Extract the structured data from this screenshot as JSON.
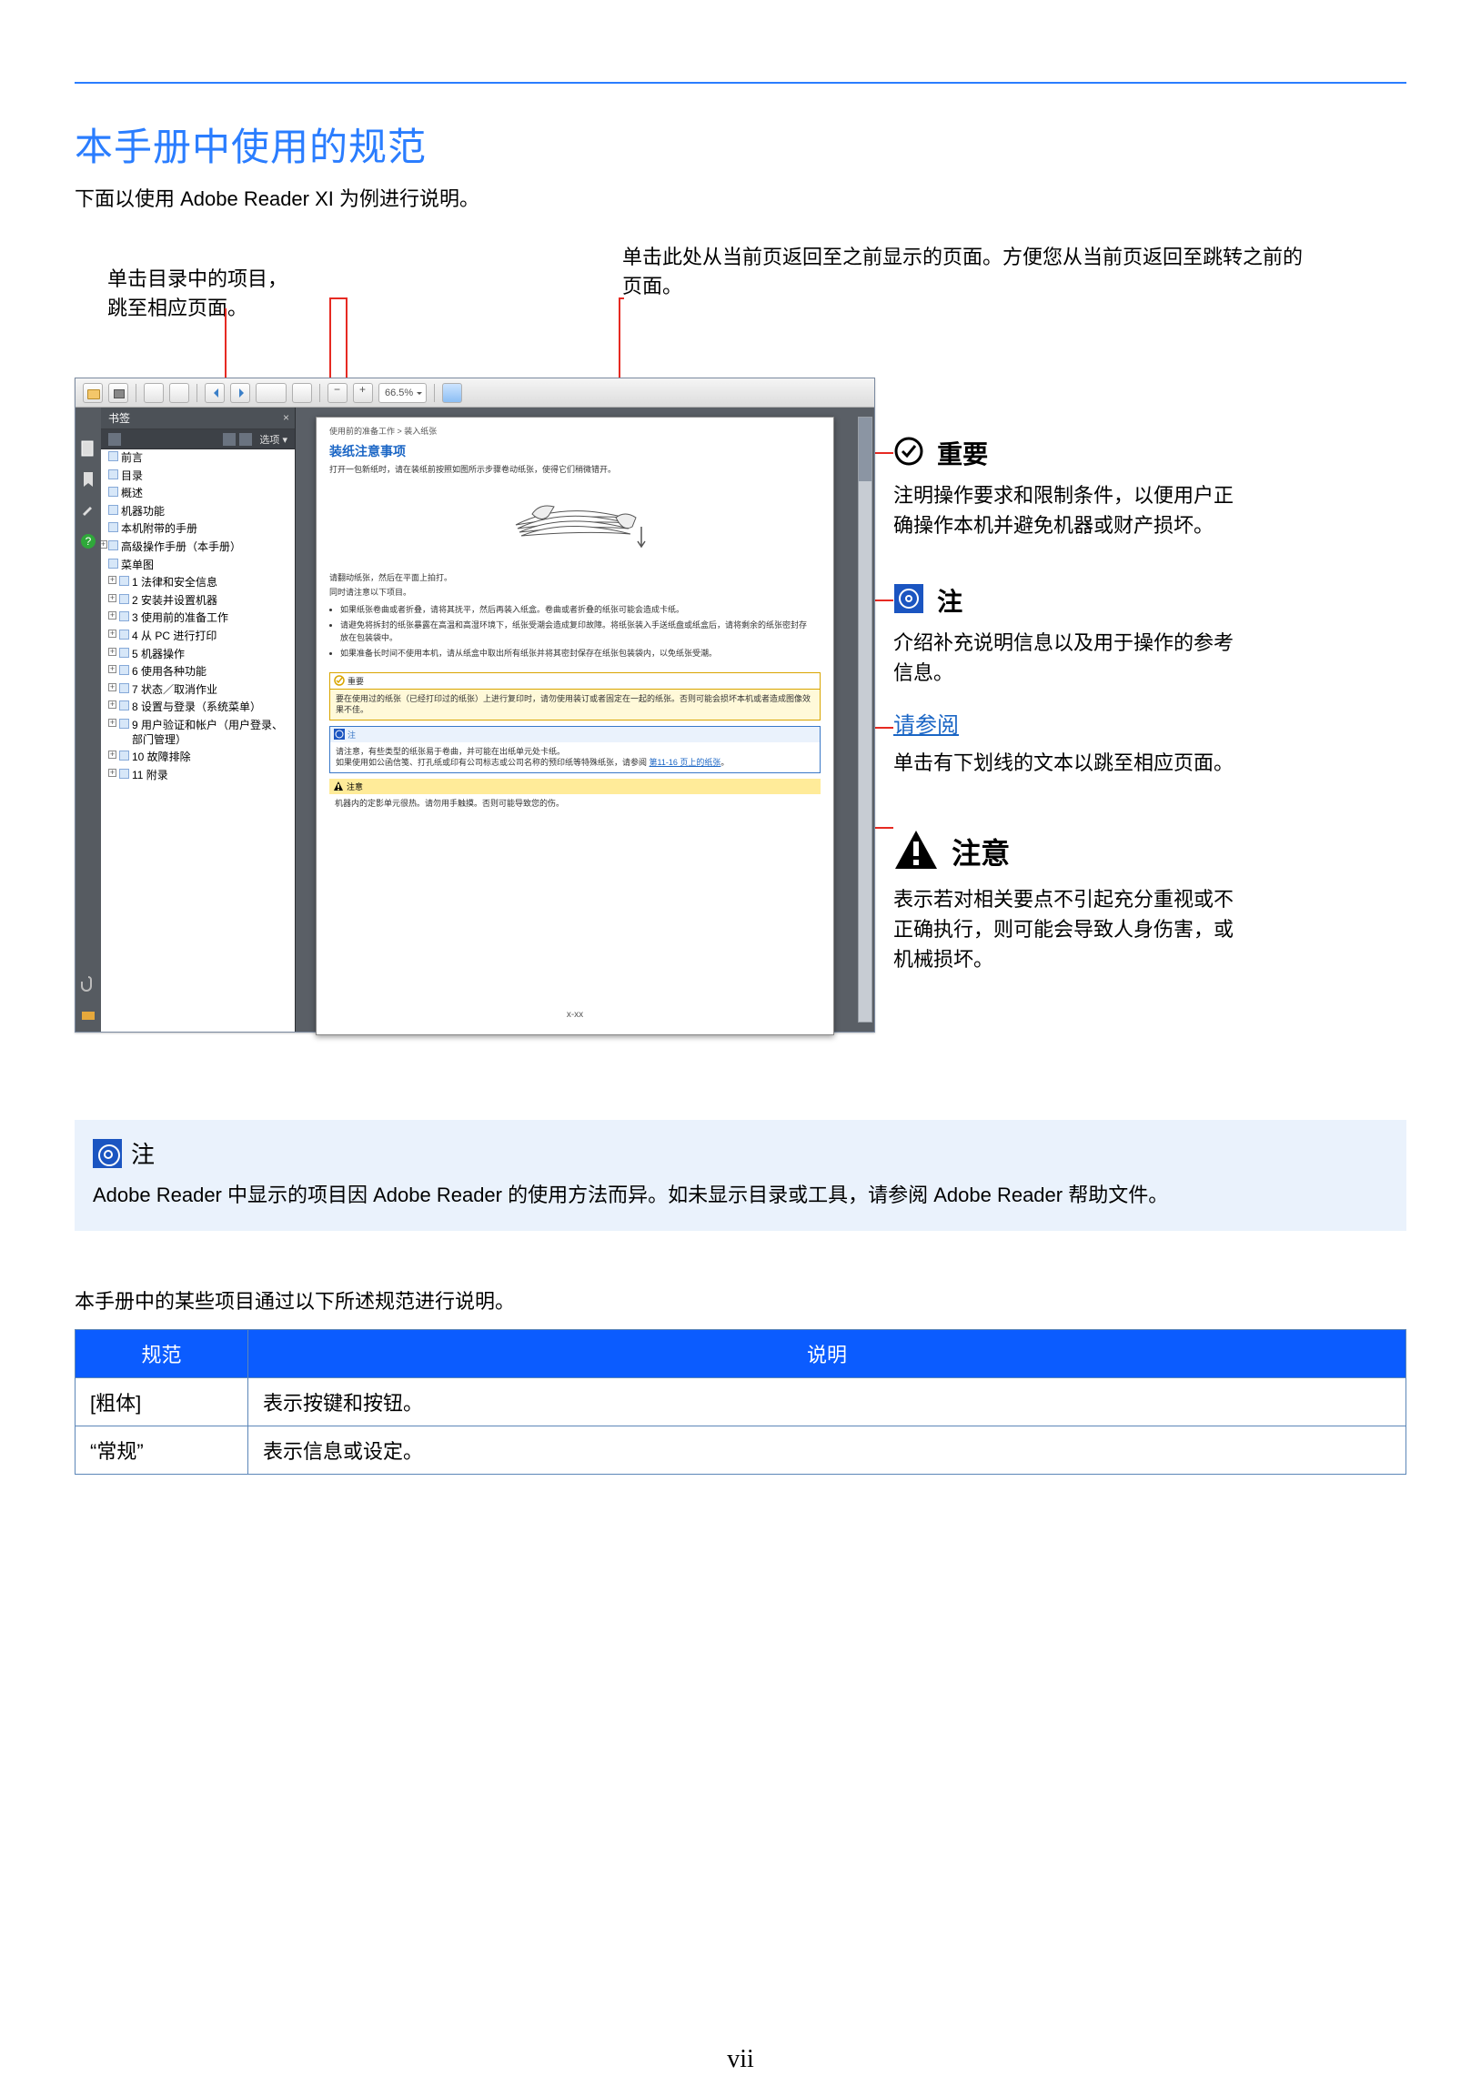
{
  "title": "本手册中使用的规范",
  "subtitle": "下面以使用 Adobe Reader XI 为例进行说明。",
  "page_number": "vii",
  "callouts": {
    "toc_click": "单击目录中的项目，\n跳至相应页面。",
    "back_button": "单击此处从当前页返回至之前显示的页面。方便您从当前页返回至跳转之前的页面。"
  },
  "legend": {
    "important": {
      "label": "重要",
      "desc": "注明操作要求和限制条件，以便用户正确操作本机并避免机器或财产损坏。"
    },
    "note": {
      "label": "注",
      "desc": "介绍补充说明信息以及用于操作的参考信息。"
    },
    "refer": {
      "link_text": "请参阅",
      "desc": "单击有下划线的文本以跳至相应页面。"
    },
    "caution": {
      "label": "注意",
      "desc": "表示若对相关要点不引起充分重视或不正确执行，则可能会导致人身伤害，或机械损坏。"
    }
  },
  "reader": {
    "zoom": "66.5%",
    "bookmark_title": "书签",
    "options_label": "选项 ▾",
    "bookmarks_top": [
      "前言",
      "目录",
      "概述",
      "机器功能",
      "本机附带的手册",
      "高级操作手册（本手册）",
      "菜单图"
    ],
    "bookmarks_num": [
      "1 法律和安全信息",
      "2 安装并设置机器",
      "3 使用前的准备工作",
      "4 从 PC 进行打印",
      "5 机器操作",
      "6 使用各种功能",
      "7 状态／取消作业",
      "8 设置与登录（系统菜单）",
      "9 用户验证和帐户（用户登录、部门管理）",
      "10 故障排除",
      "11 附录"
    ],
    "page": {
      "breadcrumb": "使用前的准备工作 > 装入纸张",
      "heading": "装纸注意事项",
      "intro": "打开一包新纸时，请在装纸前按照如图所示步骤卷动纸张，使得它们稍微错开。",
      "para1": "请翻动纸张，然后在平面上拍打。",
      "para2": "同时请注意以下项目。",
      "bullets": [
        "如果纸张卷曲或者折叠，请将其抚平，然后再装入纸盒。卷曲或者折叠的纸张可能会造成卡纸。",
        "请避免将拆封的纸张暴露在高温和高湿环境下，纸张受潮会造成复印故障。将纸张装入手送纸盘或纸盒后，请将剩余的纸张密封存放在包装袋中。",
        "如果准备长时间不使用本机，请从纸盒中取出所有纸张并将其密封保存在纸张包装袋内，以免纸张受潮。"
      ],
      "important_label": "重要",
      "important_body": "要在使用过的纸张（已经打印过的纸张）上进行复印时，请勿使用装订或者固定在一起的纸张。否则可能会损坏本机或者造成图像效果不佳。",
      "note_label": "注",
      "note_body_pre": "请注意，有些类型的纸张易于卷曲，并可能在出纸单元处卡纸。\n如果使用如公函信笺、打孔纸或印有公司标志或公司名称的预印纸等特殊纸张，请参阅",
      "note_link": "第11-16 页上的纸张",
      "note_body_post": "。",
      "caution_label": "注意",
      "caution_body": "机器内的定影单元很热。请勿用手触摸。否则可能导致您的伤。",
      "pagenum": "x-xx"
    }
  },
  "note_section": {
    "label": "注",
    "text": "Adobe Reader 中显示的项目因 Adobe Reader 的使用方法而异。如未显示目录或工具，请参阅 Adobe Reader 帮助文件。"
  },
  "table_intro": "本手册中的某些项目通过以下所述规范进行说明。",
  "table": {
    "head": [
      "规范",
      "说明"
    ],
    "rows": [
      [
        "[粗体]",
        "表示按键和按钮。"
      ],
      [
        "“常规”",
        "表示信息或设定。"
      ]
    ]
  }
}
